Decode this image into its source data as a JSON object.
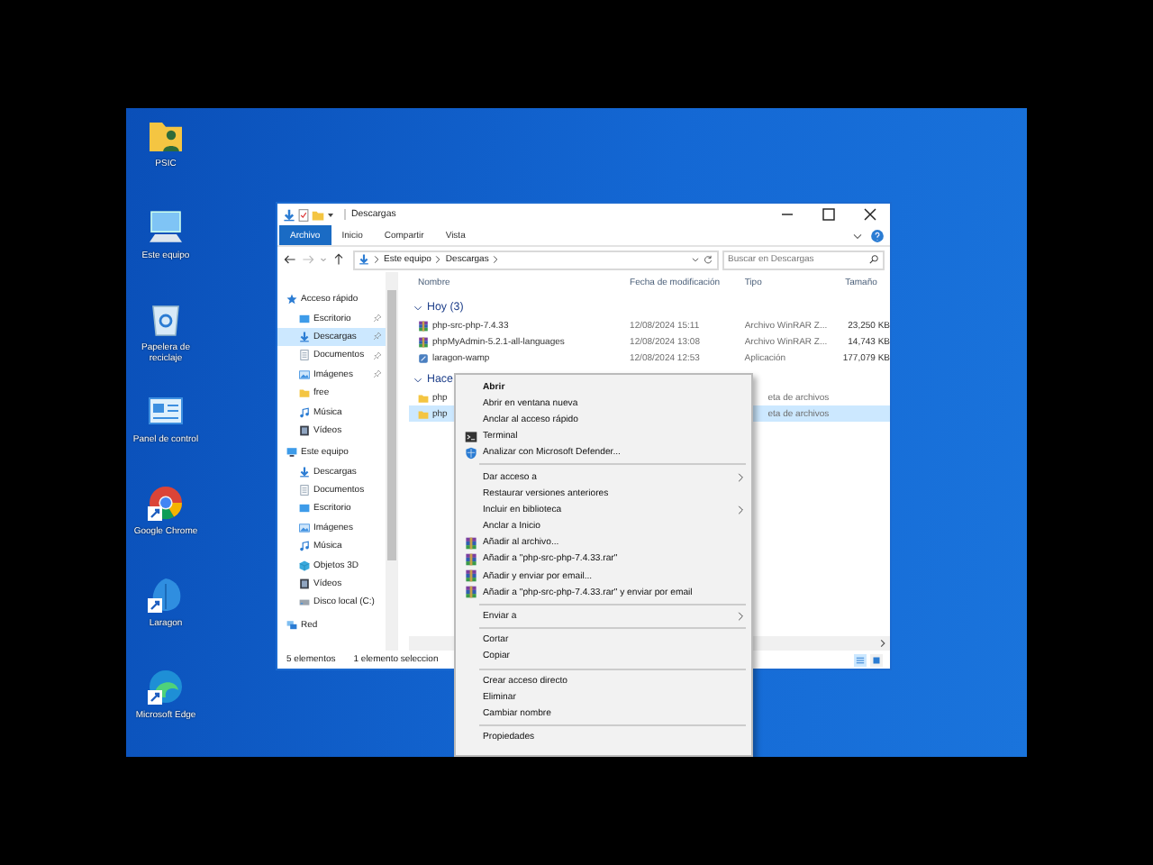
{
  "desktop_icons": [
    {
      "label": "PSIC",
      "kind": "userfolder",
      "shortcut": false
    },
    {
      "label": "Este equipo",
      "kind": "monitor",
      "shortcut": false
    },
    {
      "label": "Papelera de reciclaje",
      "kind": "recycle",
      "shortcut": false
    },
    {
      "label": "Panel de control",
      "kind": "control",
      "shortcut": false
    },
    {
      "label": "Google Chrome",
      "kind": "chrome",
      "shortcut": true
    },
    {
      "label": "Laragon",
      "kind": "appblue",
      "shortcut": true
    },
    {
      "label": "Microsoft Edge",
      "kind": "edge",
      "shortcut": true
    }
  ],
  "explorer": {
    "title": "Descargas",
    "ribbon_tabs": [
      {
        "label": "Archivo",
        "selected": true
      },
      {
        "label": "Inicio",
        "selected": false
      },
      {
        "label": "Compartir",
        "selected": false
      },
      {
        "label": "Vista",
        "selected": false
      }
    ],
    "address": [
      "Este equipo",
      "Descargas"
    ],
    "search": {
      "placeholder": "Buscar en Descargas"
    },
    "nav": [
      {
        "label": "Acceso rápido",
        "kind": "star",
        "selected": false,
        "children": [
          {
            "label": "Escritorio",
            "kind": "desktop",
            "selected": false,
            "pinned": true
          },
          {
            "label": "Descargas",
            "kind": "download",
            "selected": true,
            "pinned": true
          },
          {
            "label": "Documentos",
            "kind": "docs",
            "selected": false,
            "pinned": true
          },
          {
            "label": "Imágenes",
            "kind": "pictures",
            "selected": false,
            "pinned": true
          },
          {
            "label": "free",
            "kind": "folder",
            "selected": false,
            "pinned": false
          },
          {
            "label": "Música",
            "kind": "music",
            "selected": false,
            "pinned": false
          },
          {
            "label": "Vídeos",
            "kind": "video",
            "selected": false,
            "pinned": false
          }
        ]
      },
      {
        "label": "Este equipo",
        "kind": "pc",
        "selected": false,
        "children": [
          {
            "label": "Descargas",
            "kind": "download",
            "selected": false,
            "pinned": false
          },
          {
            "label": "Documentos",
            "kind": "docs",
            "selected": false,
            "pinned": false
          },
          {
            "label": "Escritorio",
            "kind": "desktop",
            "selected": false,
            "pinned": false
          },
          {
            "label": "Imágenes",
            "kind": "pictures",
            "selected": false,
            "pinned": false
          },
          {
            "label": "Música",
            "kind": "music",
            "selected": false,
            "pinned": false
          },
          {
            "label": "Objetos 3D",
            "kind": "cube",
            "selected": false,
            "pinned": false
          },
          {
            "label": "Vídeos",
            "kind": "video",
            "selected": false,
            "pinned": false
          },
          {
            "label": "Disco local (C:)",
            "kind": "disk",
            "selected": false,
            "pinned": false
          }
        ]
      },
      {
        "label": "Red",
        "kind": "network",
        "selected": false
      }
    ],
    "columns": [
      "Nombre",
      "Fecha de modificación",
      "Tipo",
      "Tamaño"
    ],
    "groups": [
      {
        "label": "Hoy (3)",
        "expanded": true,
        "rows": [
          {
            "name": "php-src-php-7.4.33",
            "date": "12/08/2024 15:11",
            "type": "Archivo WinRAR Z...",
            "size": "23,250 KB",
            "kind": "archive",
            "selected": false
          },
          {
            "name": "phpMyAdmin-5.2.1-all-languages",
            "date": "12/08/2024 13:08",
            "type": "Archivo WinRAR Z...",
            "size": "14,743 KB",
            "kind": "archive",
            "selected": false
          },
          {
            "name": "laragon-wamp",
            "date": "12/08/2024 12:53",
            "type": "Aplicación",
            "size": "177,079 KB",
            "kind": "app",
            "selected": false
          }
        ]
      },
      {
        "label": "Hace",
        "expanded": true,
        "rows": [
          {
            "name": "php",
            "type": "eta de archivos",
            "kind": "folder",
            "selected": false
          },
          {
            "name": "php",
            "type": "eta de archivos",
            "kind": "folder",
            "selected": true
          }
        ]
      }
    ],
    "status": [
      "5 elementos",
      "1 elemento seleccion"
    ],
    "view_modes": [
      {
        "kind": "details",
        "selected": true
      },
      {
        "kind": "tiles",
        "selected": false
      }
    ]
  },
  "context_menu": [
    {
      "kind": "item",
      "label": "Abrir",
      "default": true
    },
    {
      "kind": "item",
      "label": "Abrir en ventana nueva",
      "default": false
    },
    {
      "kind": "item",
      "label": "Anclar al acceso rápido",
      "default": false
    },
    {
      "kind": "terminal",
      "label": "Terminal",
      "default": false
    },
    {
      "kind": "shield",
      "label": "Analizar con Microsoft Defender...",
      "default": false
    },
    {
      "kind": "separator"
    },
    {
      "kind": "item",
      "label": "Dar acceso a",
      "default": false,
      "submenu": true
    },
    {
      "kind": "item",
      "label": "Restaurar versiones anteriores",
      "default": false
    },
    {
      "kind": "item",
      "label": "Incluir en biblioteca",
      "default": false,
      "submenu": true
    },
    {
      "kind": "item",
      "label": "Anclar a Inicio",
      "default": false
    },
    {
      "kind": "archive",
      "label": "Añadir al archivo...",
      "default": false
    },
    {
      "kind": "archive",
      "label": "Añadir a \"php-src-php-7.4.33.rar\"",
      "default": false
    },
    {
      "kind": "archive",
      "label": "Añadir y enviar por email...",
      "default": false
    },
    {
      "kind": "archive",
      "label": "Añadir a \"php-src-php-7.4.33.rar\" y enviar por email",
      "default": false
    },
    {
      "kind": "separator"
    },
    {
      "kind": "item",
      "label": "Enviar a",
      "default": false,
      "submenu": true
    },
    {
      "kind": "separator"
    },
    {
      "kind": "item",
      "label": "Cortar",
      "default": false
    },
    {
      "kind": "item",
      "label": "Copiar",
      "default": false
    },
    {
      "kind": "separator"
    },
    {
      "kind": "item",
      "label": "Crear acceso directo",
      "default": false
    },
    {
      "kind": "item",
      "label": "Eliminar",
      "default": false
    },
    {
      "kind": "item",
      "label": "Cambiar nombre",
      "default": false
    },
    {
      "kind": "separator"
    },
    {
      "kind": "item",
      "label": "Propiedades",
      "default": false
    }
  ]
}
